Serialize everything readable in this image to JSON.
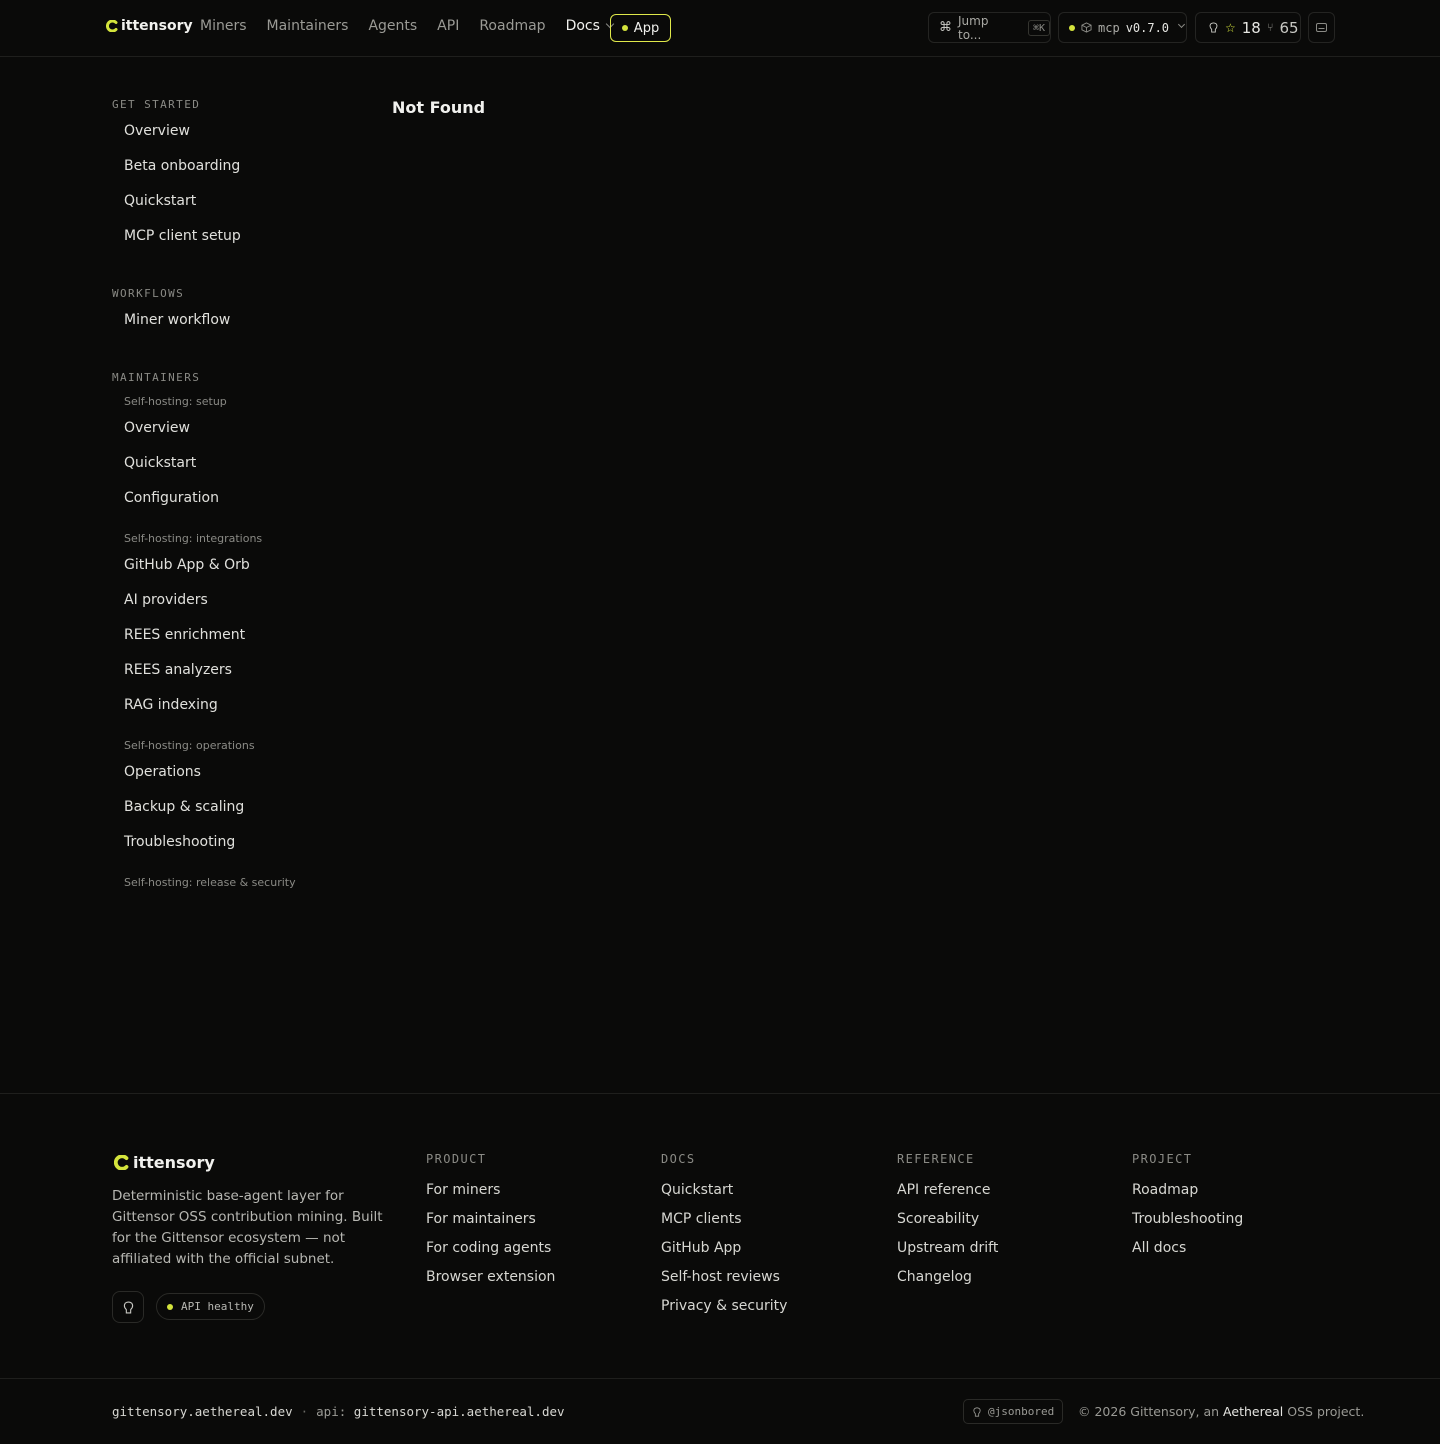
{
  "header": {
    "brand": "ittensory",
    "nav": [
      "Miners",
      "Maintainers",
      "Agents",
      "API",
      "Roadmap"
    ],
    "docs_label": "Docs",
    "app_label": "App",
    "jump_label": "Jump to...",
    "jump_shortcut": "⌘K",
    "mcp_label": "mcp",
    "mcp_version": "v0.7.0",
    "stars": "18",
    "forks": "65"
  },
  "sidebar": {
    "get_started": {
      "title": "GET STARTED",
      "items": [
        "Overview",
        "Beta onboarding",
        "Quickstart",
        "MCP client setup"
      ]
    },
    "workflows": {
      "title": "WORKFLOWS",
      "items": [
        "Miner workflow"
      ]
    },
    "maintainers": {
      "title": "MAINTAINERS",
      "setup": {
        "title": "Self-hosting: setup",
        "items": [
          "Overview",
          "Quickstart",
          "Configuration"
        ]
      },
      "integrations": {
        "title": "Self-hosting: integrations",
        "items": [
          "GitHub App & Orb",
          "AI providers",
          "REES enrichment",
          "REES analyzers",
          "RAG indexing"
        ]
      },
      "operations": {
        "title": "Self-hosting: operations",
        "items": [
          "Operations",
          "Backup & scaling",
          "Troubleshooting"
        ]
      },
      "release": {
        "title": "Self-hosting: release & security"
      }
    }
  },
  "main": {
    "title": "Not Found"
  },
  "footer": {
    "brand": "ittensory",
    "description": "Deterministic base-agent layer for Gittensor OSS contribution mining. Built for the Gittensor ecosystem — not affiliated with the official subnet.",
    "health": "API healthy",
    "columns": [
      {
        "title": "PRODUCT",
        "links": [
          "For miners",
          "For maintainers",
          "For coding agents",
          "Browser extension"
        ]
      },
      {
        "title": "DOCS",
        "links": [
          "Quickstart",
          "MCP clients",
          "GitHub App",
          "Self-host reviews",
          "Privacy & security"
        ]
      },
      {
        "title": "REFERENCE",
        "links": [
          "API reference",
          "Scoreability",
          "Upstream drift",
          "Changelog"
        ]
      },
      {
        "title": "PROJECT",
        "links": [
          "Roadmap",
          "Troubleshooting",
          "All docs"
        ]
      }
    ],
    "site": "gittensory.aethereal.dev",
    "api_label": "api:",
    "api_host": "gittensory-api.aethereal.dev",
    "author": "@jsonbored",
    "copyright_prefix": "© 2026 Gittensory, an",
    "copyright_org": "Aethereal",
    "copyright_suffix": "OSS project."
  },
  "colors": {
    "accent": "#d4e43c",
    "background": "#0a0a09"
  }
}
